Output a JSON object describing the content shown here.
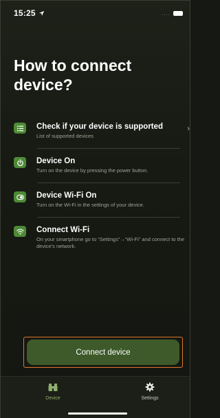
{
  "status_bar": {
    "time": "15:25",
    "signal": "....",
    "location_icon": "location-arrow-icon",
    "battery_icon": "battery-icon"
  },
  "page_title": "How to connect device?",
  "steps": [
    {
      "icon": "list-icon",
      "title": "Check if your device is supported",
      "description": "List of supported devices",
      "has_chevron": true
    },
    {
      "icon": "power-icon",
      "title": "Device On",
      "description": "Turn on the device by pressing the power button."
    },
    {
      "icon": "toggle-icon",
      "title": "Device Wi-Fi On",
      "description": "Turn on the Wi-Fi in the settings of your device."
    },
    {
      "icon": "wifi-icon",
      "title": "Connect Wi-Fi",
      "description": "On your smartphone go to “Settings”→“Wi-Fi” and connect to the device's network."
    }
  ],
  "chevron": "›",
  "connect_button_label": "Connect device",
  "tabs": [
    {
      "icon": "binoculars-icon",
      "label": "Device",
      "active": true
    },
    {
      "icon": "gear-icon",
      "label": "Settings",
      "active": false
    }
  ],
  "colors": {
    "background": "#161813",
    "accent_green": "#4e8a36",
    "button_green": "#3e5a2a",
    "highlight_orange": "#e07a2a",
    "active_tab": "#8fae6f"
  }
}
